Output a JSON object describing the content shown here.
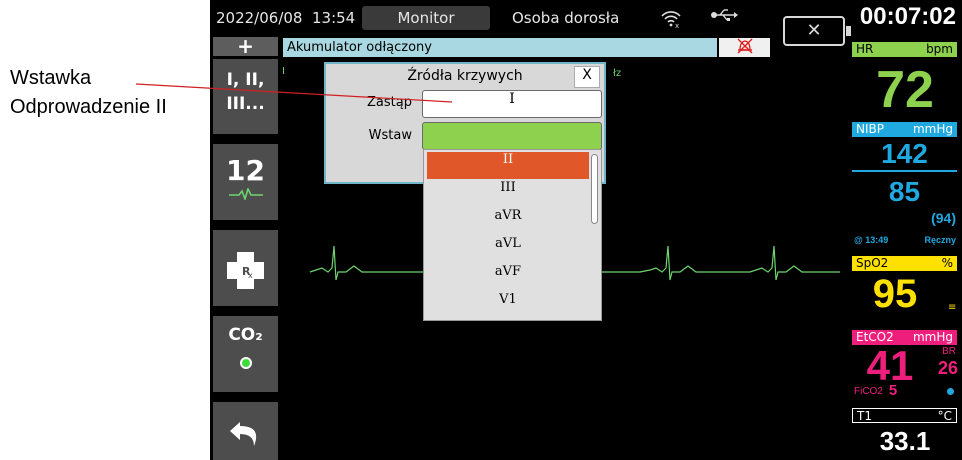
{
  "callout": {
    "line1": "Wstawka",
    "line2": "Odprowadzenie II"
  },
  "status_bar": {
    "date": "2022/06/08",
    "time": "13:54",
    "mode": "Monitor",
    "patient_type": "Osoba dorosła",
    "wifi_icon": "wifi-icon",
    "usb_icon": "usb-icon",
    "battery_icon": "battery-missing-icon",
    "elapsed_time": "00:07:02"
  },
  "alarm_bar": {
    "plus_label": "+",
    "message": "Akumulator odłączony",
    "alarm_icon": "alarm-bell-off-icon"
  },
  "softkeys": {
    "leads_line1": "I, II,",
    "leads_line2": "III...",
    "twelve_lead": "12",
    "rx_icon": "rx-cross-icon",
    "co2_label": "CO₂",
    "back_icon": "back-arrow-icon"
  },
  "trace": {
    "lead_label": "I",
    "right_fragment": "łz"
  },
  "dialog": {
    "title": "Źródła krzywych",
    "close_label": "X",
    "replace_label": "Zastąp",
    "replace_value": "I",
    "insert_label": "Wstaw",
    "insert_value": ""
  },
  "dropdown": {
    "options": [
      "II",
      "III",
      "aVR",
      "aVL",
      "aVF",
      "V1"
    ],
    "selected": "II"
  },
  "vitals": {
    "hr": {
      "label": "HR",
      "unit": "bpm",
      "value": "72",
      "color": "#8dd14f"
    },
    "nibp": {
      "label": "NIBP",
      "unit": "mmHg",
      "systolic": "142",
      "diastolic": "85",
      "mean": "(94)",
      "time": "@ 13:49",
      "mode": "Ręczny",
      "color": "#1fa9e0"
    },
    "spo2": {
      "label": "SpO2",
      "unit": "%",
      "value": "95",
      "color": "#ffe100"
    },
    "etco2": {
      "label": "EtCO2",
      "unit": "mmHg",
      "value": "41",
      "br_label": "BR",
      "br_value": "26",
      "fico2_label": "FiCO2",
      "fico2_value": "5",
      "color": "#ee1f7c"
    },
    "temp": {
      "label": "T1",
      "unit": "°C",
      "value": "33.1",
      "color": "#ffffff"
    }
  },
  "colors": {
    "ecg_trace": "#6fd36f",
    "alert_bar": "#a9d8e2",
    "dialog_border": "#6fb7c8",
    "selected_option": "#e0582a"
  }
}
